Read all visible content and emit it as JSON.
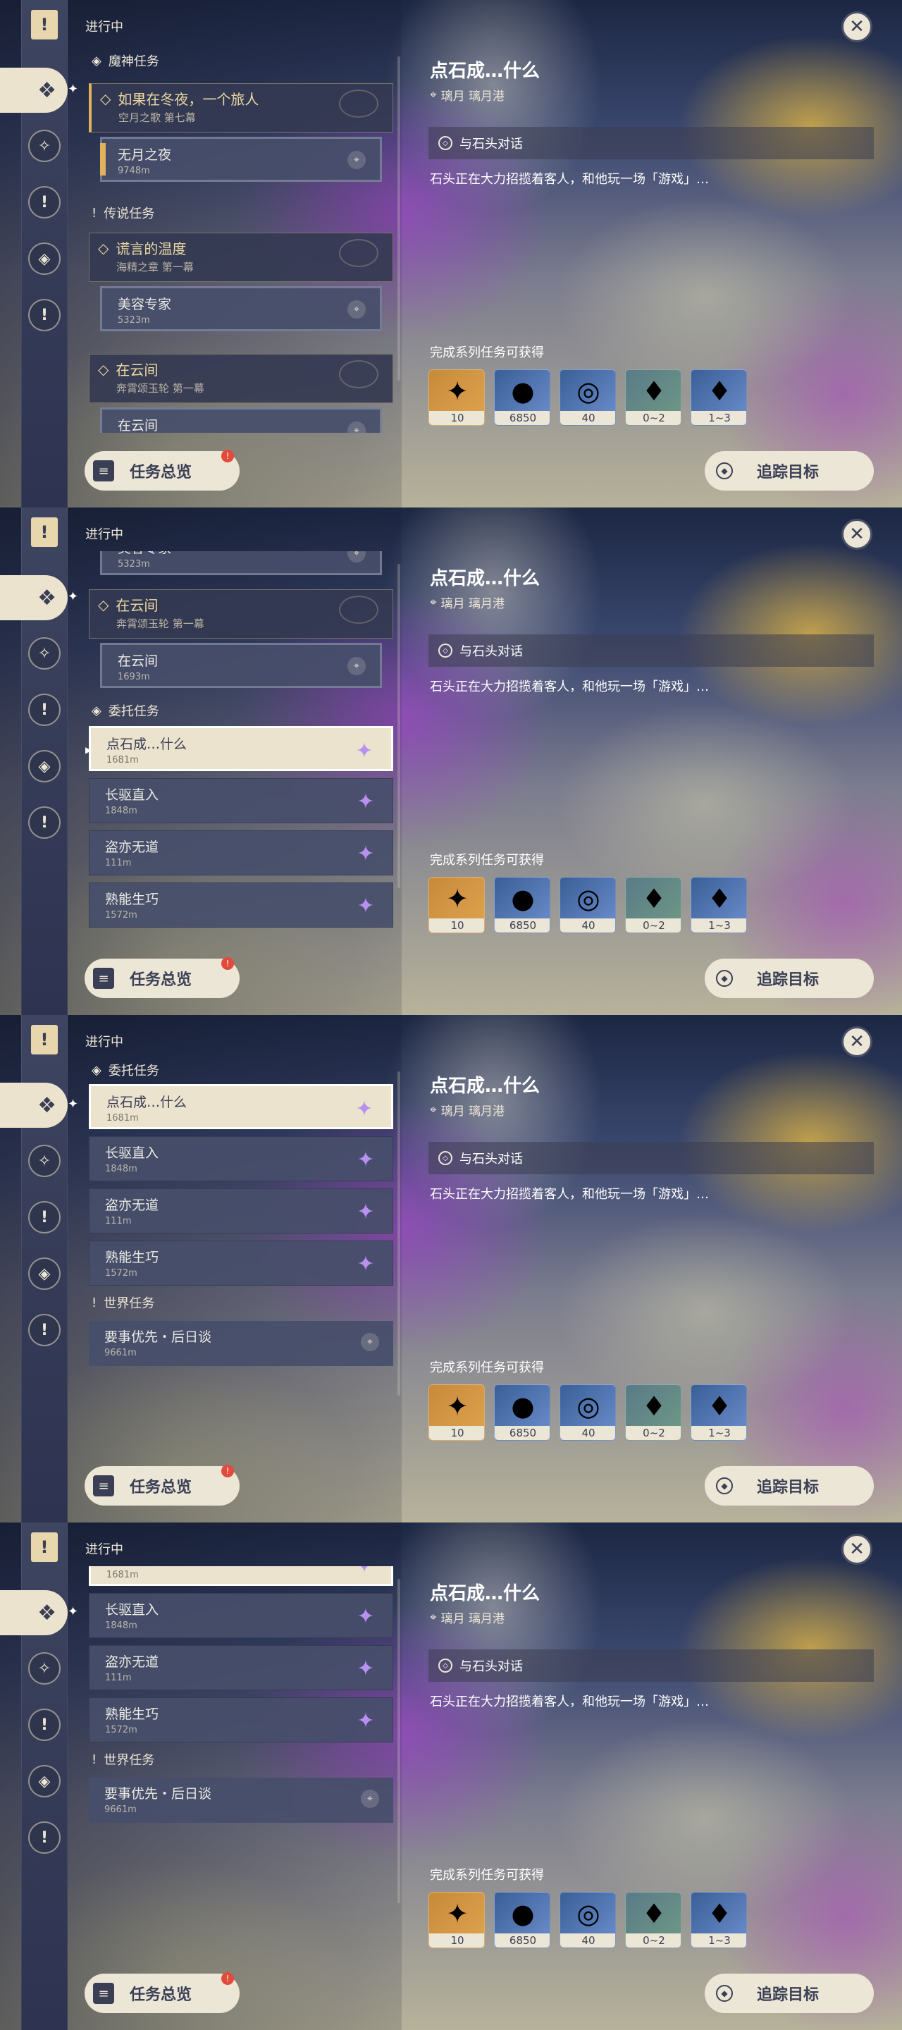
{
  "header": {
    "in_progress": "进行中"
  },
  "rail": {
    "top_icon": "bookmark-icon",
    "categories": [
      "archon-quest-icon",
      "story-quest-icon",
      "legend-quest-icon",
      "commission-icon",
      "world-quest-icon"
    ]
  },
  "sections": {
    "archon": "魔神任务",
    "legend": "传说任务",
    "commission": "委托任务",
    "world": "世界任务"
  },
  "quests": {
    "archon_main": {
      "title": "如果在冬夜，一个旅人",
      "subtitle": "空月之歌 第七幕"
    },
    "archon_sub": {
      "title": "无月之夜",
      "dist": "9748m"
    },
    "legend1_main": {
      "title": "谎言的温度",
      "subtitle": "海精之章 第一幕"
    },
    "legend1_sub": {
      "title": "美容专家",
      "dist": "5323m"
    },
    "legend2_main": {
      "title": "在云间",
      "subtitle": "奔霄颂玉轮 第一幕"
    },
    "legend2_sub": {
      "title": "在云间",
      "dist": "1693m"
    },
    "commissions": [
      {
        "title": "点石成…什么",
        "dist": "1681m"
      },
      {
        "title": "长驱直入",
        "dist": "1848m"
      },
      {
        "title": "盗亦无道",
        "dist": "111m"
      },
      {
        "title": "熟能生巧",
        "dist": "1572m"
      }
    ],
    "world_sub": {
      "title": "要事优先・后日谈",
      "dist": "9661m"
    }
  },
  "detail": {
    "title": "点石成…什么",
    "location": "璃月 璃月港",
    "objective": "与石头对话",
    "description": "石头正在大力招揽着客人，和他玩一场「游戏」…",
    "rewards_label": "完成系列任务可获得",
    "rewards": [
      {
        "icon": "primogem-icon",
        "count": "10"
      },
      {
        "icon": "mora-icon",
        "count": "6850"
      },
      {
        "icon": "adventure-exp-icon",
        "count": "40"
      },
      {
        "icon": "crystal-icon",
        "count": "0~2"
      },
      {
        "icon": "crystal-cluster-icon",
        "count": "1~3"
      }
    ]
  },
  "buttons": {
    "overview": "任务总览",
    "track": "追踪目标",
    "notify": "!"
  }
}
